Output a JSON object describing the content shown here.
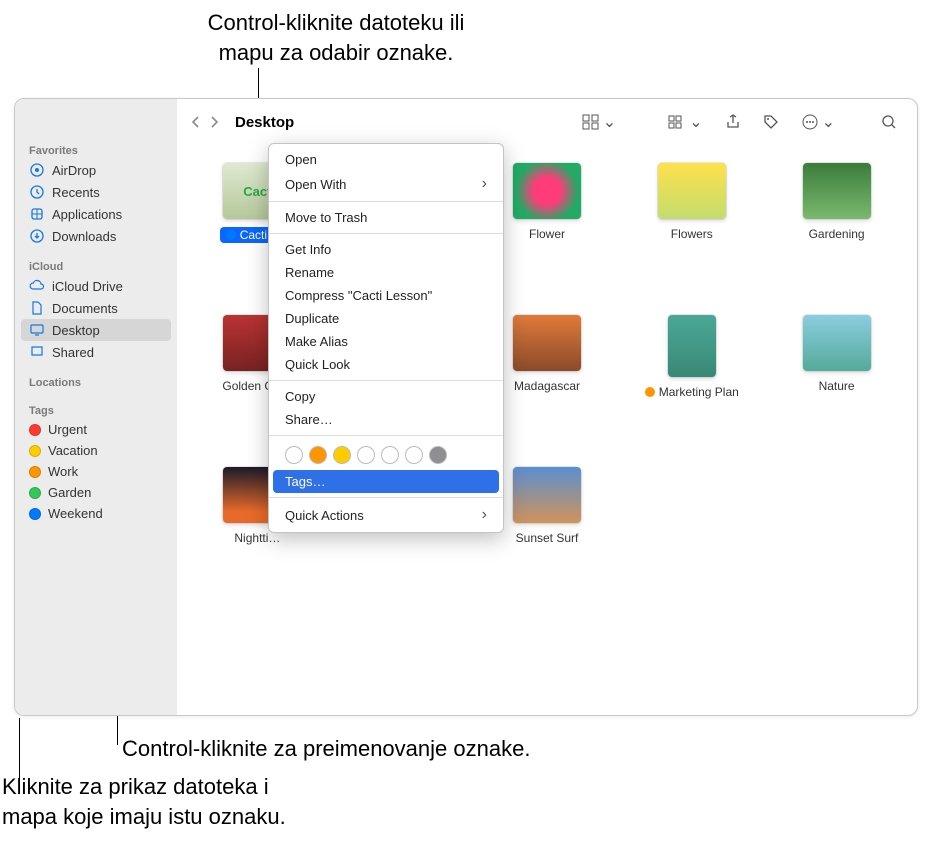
{
  "annotations": {
    "top": "Control-kliknite datoteku ili\nmapu za odabir oznake.",
    "mid": "Control-kliknite za preimenovanje oznake.",
    "bot": "Kliknite za prikaz datoteka i\nmapa koje imaju istu oznaku."
  },
  "traffic": {
    "close": "#ff5f56",
    "min": "#ffbd2e",
    "max": "#27c93f"
  },
  "sidebar": {
    "favorites_head": "Favorites",
    "favorites": [
      {
        "label": "AirDrop",
        "icon": "airdrop"
      },
      {
        "label": "Recents",
        "icon": "clock"
      },
      {
        "label": "Applications",
        "icon": "app"
      },
      {
        "label": "Downloads",
        "icon": "down"
      }
    ],
    "icloud_head": "iCloud",
    "icloud": [
      {
        "label": "iCloud Drive",
        "icon": "cloud"
      },
      {
        "label": "Documents",
        "icon": "doc"
      },
      {
        "label": "Desktop",
        "icon": "desktop",
        "selected": true
      },
      {
        "label": "Shared",
        "icon": "shared"
      }
    ],
    "locations_head": "Locations",
    "tags_head": "Tags",
    "tags": [
      {
        "label": "Urgent",
        "color": "#ff3b30"
      },
      {
        "label": "Vacation",
        "color": "#ffcc00"
      },
      {
        "label": "Work",
        "color": "#ff9500"
      },
      {
        "label": "Garden",
        "color": "#34c759"
      },
      {
        "label": "Weekend",
        "color": "#007aff"
      }
    ]
  },
  "toolbar": {
    "title": "Desktop"
  },
  "files": {
    "row1": [
      {
        "name": "Cacti L…",
        "tag": "#007aff",
        "selected": true,
        "img": "cacti"
      },
      {
        "name": "",
        "img": "district"
      },
      {
        "name": "Flower",
        "img": "flower"
      },
      {
        "name": "Flowers",
        "img": "flowers"
      },
      {
        "name": "Gardening",
        "img": "garden"
      }
    ],
    "row2": [
      {
        "name": "Golden Ga…",
        "img": "golden"
      },
      {
        "name": "Madagascar",
        "img": "mad"
      },
      {
        "name": "Marketing Plan",
        "tag": "#ff9500",
        "img": "mkt"
      },
      {
        "name": "Nature",
        "img": "nature"
      }
    ],
    "row3": [
      {
        "name": "Nightti…",
        "img": "night"
      },
      {
        "name": "Sunset Surf",
        "img": "sunset"
      }
    ]
  },
  "ctx": {
    "items": [
      "Open",
      {
        "label": "Open With",
        "sub": true
      },
      "---",
      "Move to Trash",
      "---",
      "Get Info",
      "Rename",
      "Compress \"Cacti Lesson\"",
      "Duplicate",
      "Make Alias",
      "Quick Look",
      "---",
      "Copy",
      "Share…",
      "---",
      "TAGROW",
      {
        "label": "Tags…",
        "hl": true
      },
      "---",
      {
        "label": "Quick Actions",
        "sub": true
      }
    ],
    "tag_colors": [
      "",
      "#ff9500",
      "#ffcc00",
      "",
      "",
      "",
      "#8e8e93"
    ]
  }
}
